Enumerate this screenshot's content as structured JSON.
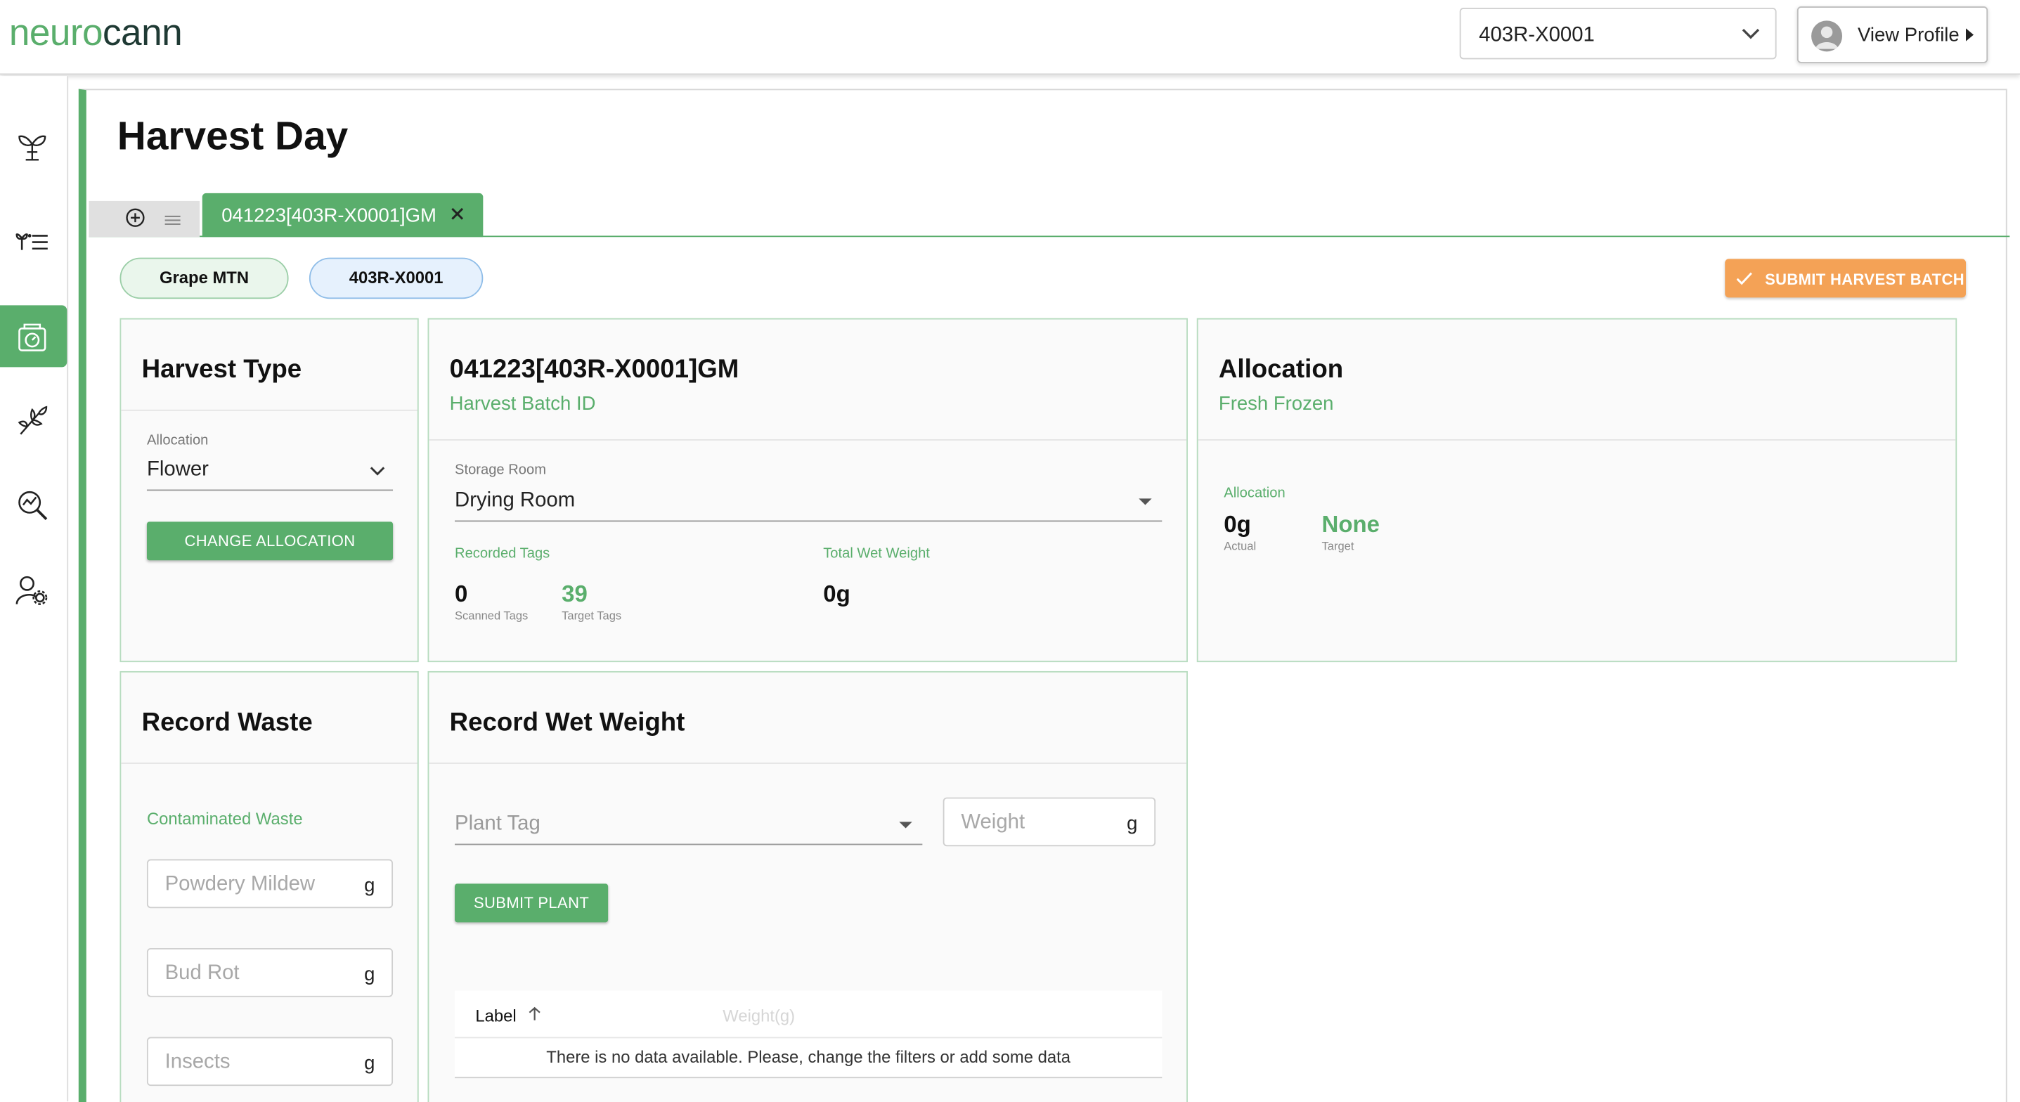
{
  "brand": {
    "part1": "neuro",
    "part2": "cann",
    "colors": {
      "accent": "#5aae6c",
      "dark": "#1f3a34",
      "orange": "#f4a256"
    }
  },
  "header": {
    "bed_select_value": "403R-X0001",
    "profile_label": "View Profile"
  },
  "sidebar": {
    "items": [
      {
        "icon": "plants-icon",
        "active": false
      },
      {
        "icon": "plant-list-icon",
        "active": false
      },
      {
        "icon": "scale-icon",
        "active": true
      },
      {
        "icon": "harvest-icon",
        "active": false
      },
      {
        "icon": "analytics-search-icon",
        "active": false
      },
      {
        "icon": "user-settings-icon",
        "active": false
      }
    ]
  },
  "page": {
    "title": "Harvest Day"
  },
  "tabs": [
    {
      "label": "041223[403R-X0001]GM"
    }
  ],
  "chips": {
    "strain": "Grape MTN",
    "bed": "403R-X0001"
  },
  "actions": {
    "submit_batch": "SUBMIT HARVEST BATCH"
  },
  "harvest_type": {
    "title": "Harvest Type",
    "allocation_label": "Allocation",
    "allocation_value": "Flower",
    "change_button": "CHANGE ALLOCATION"
  },
  "batch": {
    "title": "041223[403R-X0001]GM",
    "subtitle": "Harvest Batch ID",
    "storage_label": "Storage Room",
    "storage_value": "Drying Room",
    "recorded_tags_label": "Recorded Tags",
    "scanned_value": "0",
    "scanned_label": "Scanned Tags",
    "target_value": "39",
    "target_label": "Target Tags",
    "wet_weight_label": "Total Wet Weight",
    "wet_weight_value": "0g"
  },
  "allocation": {
    "title": "Allocation",
    "subtitle": "Fresh Frozen",
    "label": "Allocation",
    "actual_value": "0g",
    "actual_label": "Actual",
    "target_value": "None",
    "target_label": "Target"
  },
  "waste": {
    "title": "Record Waste",
    "section_label": "Contaminated Waste",
    "fields": [
      {
        "placeholder": "Powdery Mildew",
        "unit": "g"
      },
      {
        "placeholder": "Bud Rot",
        "unit": "g"
      },
      {
        "placeholder": "Insects",
        "unit": "g"
      }
    ]
  },
  "wet_weight": {
    "title": "Record Wet Weight",
    "plant_tag_placeholder": "Plant Tag",
    "weight_placeholder": "Weight",
    "weight_unit": "g",
    "submit_button": "SUBMIT PLANT",
    "table": {
      "columns": [
        "Label",
        "Weight(g)"
      ],
      "empty_message": "There is no data available. Please, change the filters or add some data"
    }
  }
}
